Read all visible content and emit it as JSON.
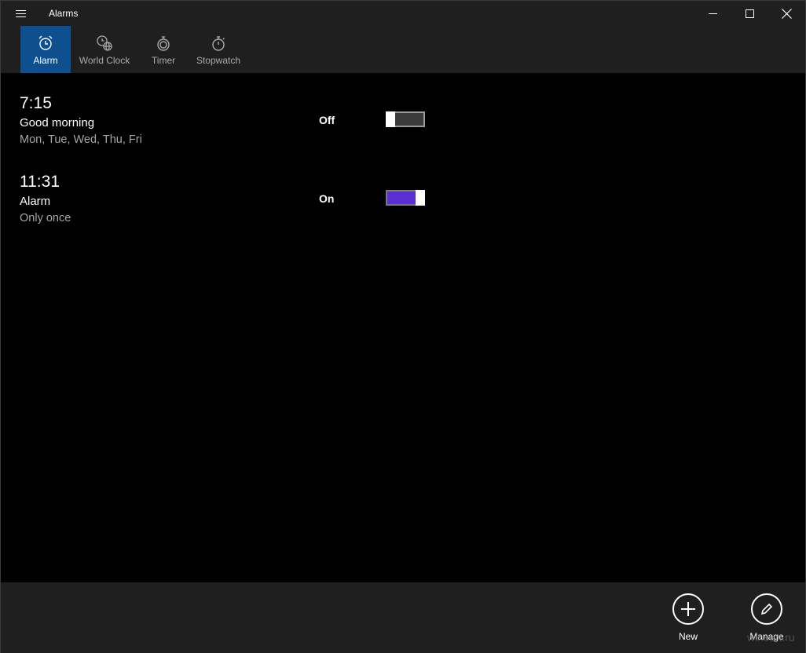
{
  "window": {
    "title": "Alarms"
  },
  "tabs": [
    {
      "label": "Alarm",
      "icon": "alarm-clock-icon",
      "active": true
    },
    {
      "label": "World Clock",
      "icon": "world-clock-icon",
      "active": false
    },
    {
      "label": "Timer",
      "icon": "timer-icon",
      "active": false
    },
    {
      "label": "Stopwatch",
      "icon": "stopwatch-icon",
      "active": false
    }
  ],
  "alarms": [
    {
      "time": "7:15",
      "name": "Good morning",
      "days": "Mon, Tue, Wed, Thu, Fri",
      "state": "Off",
      "enabled": false
    },
    {
      "time": "11:31",
      "name": "Alarm",
      "days": "Only once",
      "state": "On",
      "enabled": true
    }
  ],
  "appbar": {
    "new_label": "New",
    "manage_label": "Manage"
  },
  "watermark": "winsert.ru",
  "colors": {
    "accent": "#0d4f8f",
    "toggle_on": "#5b2ed4",
    "chrome": "#1f1f1f",
    "background": "#000000"
  }
}
